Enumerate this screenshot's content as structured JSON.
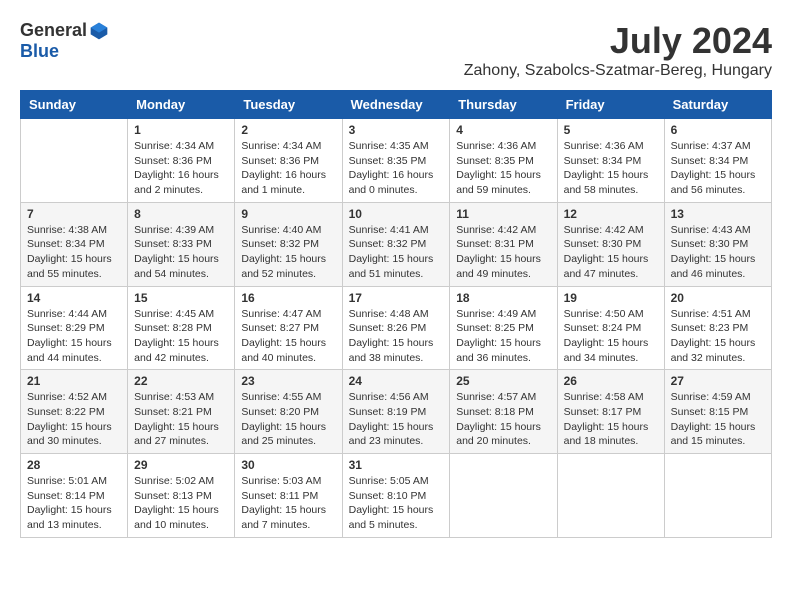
{
  "logo": {
    "general": "General",
    "blue": "Blue"
  },
  "header": {
    "month_title": "July 2024",
    "location": "Zahony, Szabolcs-Szatmar-Bereg, Hungary"
  },
  "days_of_week": [
    "Sunday",
    "Monday",
    "Tuesday",
    "Wednesday",
    "Thursday",
    "Friday",
    "Saturday"
  ],
  "weeks": [
    [
      {
        "day": "",
        "info": ""
      },
      {
        "day": "1",
        "info": "Sunrise: 4:34 AM\nSunset: 8:36 PM\nDaylight: 16 hours\nand 2 minutes."
      },
      {
        "day": "2",
        "info": "Sunrise: 4:34 AM\nSunset: 8:36 PM\nDaylight: 16 hours\nand 1 minute."
      },
      {
        "day": "3",
        "info": "Sunrise: 4:35 AM\nSunset: 8:35 PM\nDaylight: 16 hours\nand 0 minutes."
      },
      {
        "day": "4",
        "info": "Sunrise: 4:36 AM\nSunset: 8:35 PM\nDaylight: 15 hours\nand 59 minutes."
      },
      {
        "day": "5",
        "info": "Sunrise: 4:36 AM\nSunset: 8:34 PM\nDaylight: 15 hours\nand 58 minutes."
      },
      {
        "day": "6",
        "info": "Sunrise: 4:37 AM\nSunset: 8:34 PM\nDaylight: 15 hours\nand 56 minutes."
      }
    ],
    [
      {
        "day": "7",
        "info": "Sunrise: 4:38 AM\nSunset: 8:34 PM\nDaylight: 15 hours\nand 55 minutes."
      },
      {
        "day": "8",
        "info": "Sunrise: 4:39 AM\nSunset: 8:33 PM\nDaylight: 15 hours\nand 54 minutes."
      },
      {
        "day": "9",
        "info": "Sunrise: 4:40 AM\nSunset: 8:32 PM\nDaylight: 15 hours\nand 52 minutes."
      },
      {
        "day": "10",
        "info": "Sunrise: 4:41 AM\nSunset: 8:32 PM\nDaylight: 15 hours\nand 51 minutes."
      },
      {
        "day": "11",
        "info": "Sunrise: 4:42 AM\nSunset: 8:31 PM\nDaylight: 15 hours\nand 49 minutes."
      },
      {
        "day": "12",
        "info": "Sunrise: 4:42 AM\nSunset: 8:30 PM\nDaylight: 15 hours\nand 47 minutes."
      },
      {
        "day": "13",
        "info": "Sunrise: 4:43 AM\nSunset: 8:30 PM\nDaylight: 15 hours\nand 46 minutes."
      }
    ],
    [
      {
        "day": "14",
        "info": "Sunrise: 4:44 AM\nSunset: 8:29 PM\nDaylight: 15 hours\nand 44 minutes."
      },
      {
        "day": "15",
        "info": "Sunrise: 4:45 AM\nSunset: 8:28 PM\nDaylight: 15 hours\nand 42 minutes."
      },
      {
        "day": "16",
        "info": "Sunrise: 4:47 AM\nSunset: 8:27 PM\nDaylight: 15 hours\nand 40 minutes."
      },
      {
        "day": "17",
        "info": "Sunrise: 4:48 AM\nSunset: 8:26 PM\nDaylight: 15 hours\nand 38 minutes."
      },
      {
        "day": "18",
        "info": "Sunrise: 4:49 AM\nSunset: 8:25 PM\nDaylight: 15 hours\nand 36 minutes."
      },
      {
        "day": "19",
        "info": "Sunrise: 4:50 AM\nSunset: 8:24 PM\nDaylight: 15 hours\nand 34 minutes."
      },
      {
        "day": "20",
        "info": "Sunrise: 4:51 AM\nSunset: 8:23 PM\nDaylight: 15 hours\nand 32 minutes."
      }
    ],
    [
      {
        "day": "21",
        "info": "Sunrise: 4:52 AM\nSunset: 8:22 PM\nDaylight: 15 hours\nand 30 minutes."
      },
      {
        "day": "22",
        "info": "Sunrise: 4:53 AM\nSunset: 8:21 PM\nDaylight: 15 hours\nand 27 minutes."
      },
      {
        "day": "23",
        "info": "Sunrise: 4:55 AM\nSunset: 8:20 PM\nDaylight: 15 hours\nand 25 minutes."
      },
      {
        "day": "24",
        "info": "Sunrise: 4:56 AM\nSunset: 8:19 PM\nDaylight: 15 hours\nand 23 minutes."
      },
      {
        "day": "25",
        "info": "Sunrise: 4:57 AM\nSunset: 8:18 PM\nDaylight: 15 hours\nand 20 minutes."
      },
      {
        "day": "26",
        "info": "Sunrise: 4:58 AM\nSunset: 8:17 PM\nDaylight: 15 hours\nand 18 minutes."
      },
      {
        "day": "27",
        "info": "Sunrise: 4:59 AM\nSunset: 8:15 PM\nDaylight: 15 hours\nand 15 minutes."
      }
    ],
    [
      {
        "day": "28",
        "info": "Sunrise: 5:01 AM\nSunset: 8:14 PM\nDaylight: 15 hours\nand 13 minutes."
      },
      {
        "day": "29",
        "info": "Sunrise: 5:02 AM\nSunset: 8:13 PM\nDaylight: 15 hours\nand 10 minutes."
      },
      {
        "day": "30",
        "info": "Sunrise: 5:03 AM\nSunset: 8:11 PM\nDaylight: 15 hours\nand 7 minutes."
      },
      {
        "day": "31",
        "info": "Sunrise: 5:05 AM\nSunset: 8:10 PM\nDaylight: 15 hours\nand 5 minutes."
      },
      {
        "day": "",
        "info": ""
      },
      {
        "day": "",
        "info": ""
      },
      {
        "day": "",
        "info": ""
      }
    ]
  ]
}
